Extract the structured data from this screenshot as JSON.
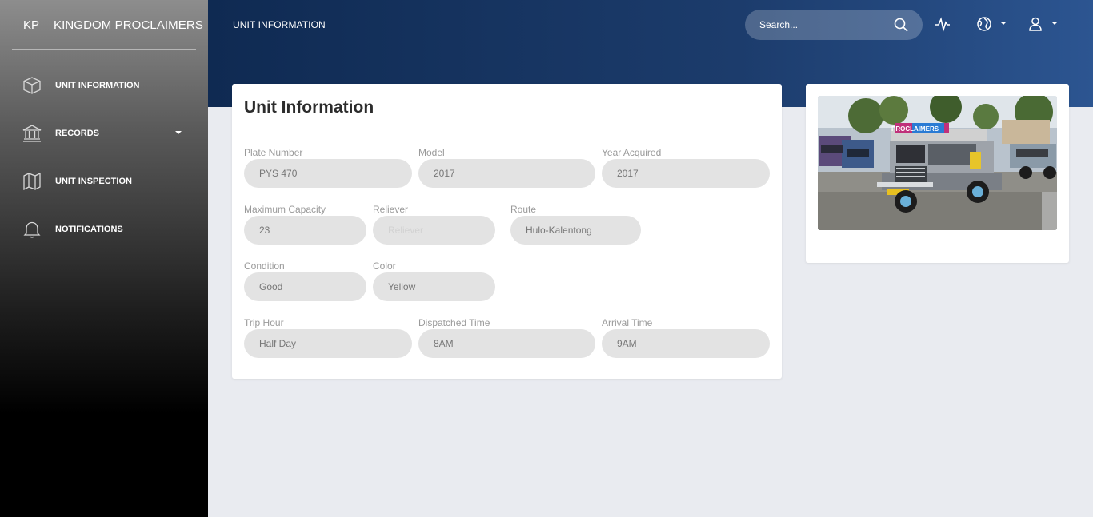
{
  "sidebar": {
    "brand_mini": "KP",
    "brand_name": "KINGDOM PROCLAIMERS",
    "items": [
      {
        "label": "UNIT INFORMATION",
        "icon": "box-icon"
      },
      {
        "label": "RECORDS",
        "icon": "bank-icon"
      },
      {
        "label": "UNIT INSPECTION",
        "icon": "map-icon"
      },
      {
        "label": "NOTIFICATIONS",
        "icon": "bell-icon"
      }
    ]
  },
  "header": {
    "title": "UNIT INFORMATION",
    "search_placeholder": "Search...",
    "icons": [
      "pulse-icon",
      "globe-icon",
      "user-icon"
    ]
  },
  "card": {
    "title": "Unit Information",
    "fields": {
      "plate_number": {
        "label": "Plate Number",
        "value": "PYS 470"
      },
      "model": {
        "label": "Model",
        "value": "2017"
      },
      "year_acquired": {
        "label": "Year Acquired",
        "value": "2017"
      },
      "maximum_capacity": {
        "label": "Maximum Capacity",
        "value": "23"
      },
      "reliever": {
        "label": "Reliever",
        "placeholder": "Reliever"
      },
      "route": {
        "label": "Route",
        "value": "Hulo-Kalentong"
      },
      "condition": {
        "label": "Condition",
        "value": "Good"
      },
      "color": {
        "label": "Color",
        "value": "Yellow"
      },
      "trip_hour": {
        "label": "Trip Hour",
        "value": "Half Day"
      },
      "dispatched_time": {
        "label": "Dispatched Time",
        "value": "8AM"
      },
      "arrival_time": {
        "label": "Arrival Time",
        "value": "9AM"
      }
    }
  },
  "photo": {
    "banner_text": "PROCLAIMERS"
  },
  "colors": {
    "header_dark": "#0f2a52",
    "header_light": "#2c5591",
    "page_bg": "#e9ebf0",
    "field_bg": "#e3e3e3"
  }
}
